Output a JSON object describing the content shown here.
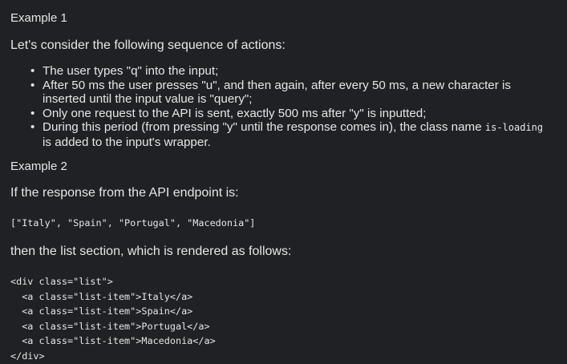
{
  "example1": {
    "title": "Example 1",
    "intro": "Let's consider the following sequence of actions:",
    "bullets": [
      {
        "lines": [
          "The user types \"q\" into the input;"
        ]
      },
      {
        "lines": [
          "After 50 ms the user presses \"u\", and then again, after every 50 ms, a new character is",
          "inserted until the input value is \"query\";"
        ]
      },
      {
        "lines": [
          "Only one request to the API is sent, exactly 500 ms after \"y\" is inputted;"
        ]
      },
      {
        "text_before": "During this period (from pressing \"y\" until the response comes in), the class name ",
        "code": "is-loading",
        "line2": "is added to the input's wrapper."
      }
    ]
  },
  "example2": {
    "title": "Example 2",
    "intro": "If the response from the API endpoint is:",
    "response_code": "[\"Italy\", \"Spain\", \"Portugal\", \"Macedonia\"]",
    "outro": "then the list section, which is rendered as follows:",
    "html_lines": [
      "<div class=\"list\">",
      "  <a class=\"list-item\">Italy</a>",
      "  <a class=\"list-item\">Spain</a>",
      "  <a class=\"list-item\">Portugal</a>",
      "  <a class=\"list-item\">Macedonia</a>",
      "</div>"
    ]
  }
}
